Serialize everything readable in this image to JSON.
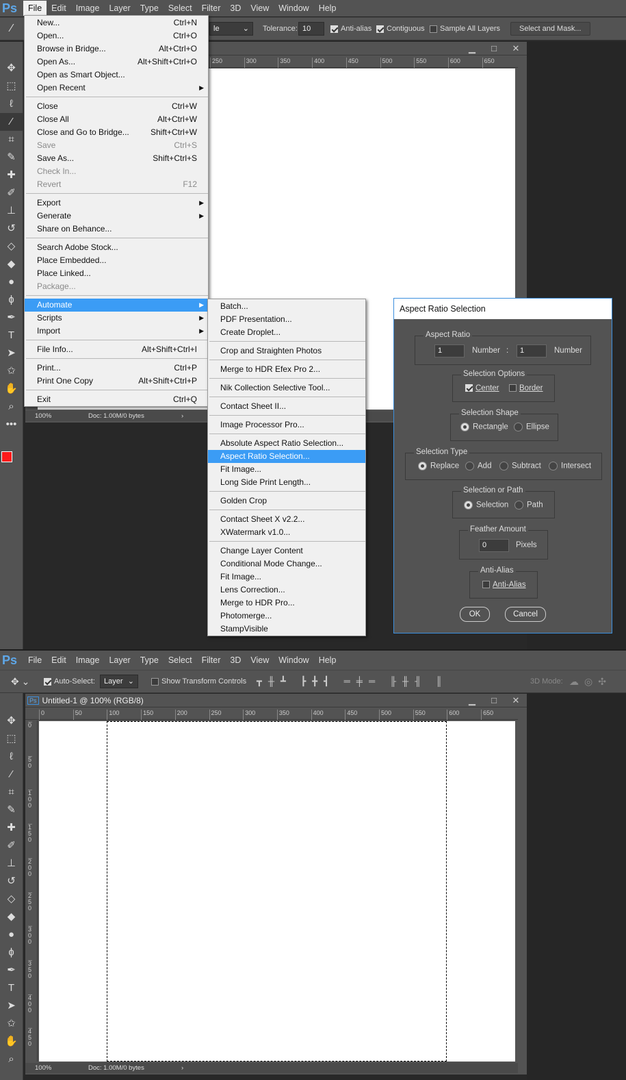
{
  "app_logo": "Ps",
  "menu": [
    "File",
    "Edit",
    "Image",
    "Layer",
    "Type",
    "Select",
    "Filter",
    "3D",
    "View",
    "Window",
    "Help"
  ],
  "top_options": {
    "style_value": "le",
    "tolerance_label": "Tolerance:",
    "tolerance_value": "10",
    "anti_alias": "Anti-alias",
    "anti_alias_checked": true,
    "contiguous": "Contiguous",
    "contiguous_checked": true,
    "sample_all": "Sample All Layers",
    "sample_all_checked": false,
    "select_mask": "Select and Mask..."
  },
  "bottom_options": {
    "auto_select": "Auto-Select:",
    "auto_select_checked": true,
    "layer_value": "Layer",
    "show_transform": "Show Transform Controls",
    "show_transform_checked": false,
    "mode_3d": "3D Mode:"
  },
  "document": {
    "title": "Untitled-1 @ 100% (RGB/8)",
    "zoom": "100%",
    "doc_info": "Doc: 1.00M/0 bytes",
    "hruler_top": [
      "250",
      "300",
      "350",
      "400",
      "450",
      "500",
      "550",
      "600",
      "650"
    ],
    "hruler": [
      "0",
      "50",
      "100",
      "150",
      "200",
      "250",
      "300",
      "350",
      "400",
      "450",
      "500",
      "550",
      "600",
      "650"
    ],
    "vruler": [
      "0",
      "50",
      "100",
      "150",
      "200",
      "250",
      "300",
      "350",
      "400",
      "450"
    ]
  },
  "colors": {
    "foreground": "#ff1a1a",
    "background": "#ffffff",
    "highlight": "#3b9cf5",
    "dialog_border": "#3c8fde"
  },
  "tools": [
    "move",
    "marquee",
    "lasso",
    "magic-wand",
    "crop",
    "eyedropper",
    "healing",
    "brush",
    "stamp",
    "history-brush",
    "eraser",
    "paint-bucket",
    "blur",
    "dodge",
    "pen",
    "type",
    "path-select",
    "shape",
    "hand",
    "zoom"
  ],
  "file_menu": [
    {
      "label": "New...",
      "sc": "Ctrl+N"
    },
    {
      "label": "Open...",
      "sc": "Ctrl+O"
    },
    {
      "label": "Browse in Bridge...",
      "sc": "Alt+Ctrl+O"
    },
    {
      "label": "Open As...",
      "sc": "Alt+Shift+Ctrl+O"
    },
    {
      "label": "Open as Smart Object..."
    },
    {
      "label": "Open Recent",
      "sub": true
    },
    {
      "sep": true
    },
    {
      "label": "Close",
      "sc": "Ctrl+W"
    },
    {
      "label": "Close All",
      "sc": "Alt+Ctrl+W"
    },
    {
      "label": "Close and Go to Bridge...",
      "sc": "Shift+Ctrl+W"
    },
    {
      "label": "Save",
      "sc": "Ctrl+S",
      "dis": true
    },
    {
      "label": "Save As...",
      "sc": "Shift+Ctrl+S"
    },
    {
      "label": "Check In...",
      "dis": true
    },
    {
      "label": "Revert",
      "sc": "F12",
      "dis": true
    },
    {
      "sep": true
    },
    {
      "label": "Export",
      "sub": true
    },
    {
      "label": "Generate",
      "sub": true
    },
    {
      "label": "Share on Behance..."
    },
    {
      "sep": true
    },
    {
      "label": "Search Adobe Stock..."
    },
    {
      "label": "Place Embedded..."
    },
    {
      "label": "Place Linked..."
    },
    {
      "label": "Package...",
      "dis": true
    },
    {
      "sep": true
    },
    {
      "label": "Automate",
      "sub": true,
      "hl": true
    },
    {
      "label": "Scripts",
      "sub": true
    },
    {
      "label": "Import",
      "sub": true
    },
    {
      "sep": true
    },
    {
      "label": "File Info...",
      "sc": "Alt+Shift+Ctrl+I"
    },
    {
      "sep": true
    },
    {
      "label": "Print...",
      "sc": "Ctrl+P"
    },
    {
      "label": "Print One Copy",
      "sc": "Alt+Shift+Ctrl+P"
    },
    {
      "sep": true
    },
    {
      "label": "Exit",
      "sc": "Ctrl+Q"
    }
  ],
  "automate_menu": [
    {
      "label": "Batch..."
    },
    {
      "label": "PDF Presentation..."
    },
    {
      "label": "Create Droplet..."
    },
    {
      "sep": true
    },
    {
      "label": "Crop and Straighten Photos"
    },
    {
      "sep": true
    },
    {
      "label": "Merge to HDR Efex Pro 2..."
    },
    {
      "sep": true
    },
    {
      "label": "Nik Collection Selective Tool..."
    },
    {
      "sep": true
    },
    {
      "label": "Contact Sheet II..."
    },
    {
      "sep": true
    },
    {
      "label": "Image Processor Pro..."
    },
    {
      "sep": true
    },
    {
      "label": "Absolute Aspect Ratio Selection..."
    },
    {
      "label": "Aspect Ratio Selection...",
      "hl": true
    },
    {
      "label": "Fit Image..."
    },
    {
      "label": "Long Side Print Length..."
    },
    {
      "sep": true
    },
    {
      "label": "Golden Crop"
    },
    {
      "sep": true
    },
    {
      "label": "Contact Sheet X v2.2..."
    },
    {
      "label": "XWatermark v1.0..."
    },
    {
      "sep": true
    },
    {
      "label": "Change Layer Content"
    },
    {
      "label": "Conditional Mode Change..."
    },
    {
      "label": "Fit Image..."
    },
    {
      "label": "Lens Correction..."
    },
    {
      "label": "Merge to HDR Pro..."
    },
    {
      "label": "Photomerge..."
    },
    {
      "label": "StampVisible"
    }
  ],
  "dialog": {
    "title": "Aspect Ratio Selection",
    "aspect_ratio": {
      "label": "Aspect Ratio",
      "a": "1",
      "b": "1",
      "unit": "Number",
      "colon": ":"
    },
    "options": {
      "label": "Selection Options",
      "center": "Center",
      "center_checked": true,
      "border": "Border",
      "border_checked": false
    },
    "shape": {
      "label": "Selection Shape",
      "rectangle": "Rectangle",
      "ellipse": "Ellipse",
      "selected": "Rectangle"
    },
    "type": {
      "label": "Selection Type",
      "replace": "Replace",
      "add": "Add",
      "subtract": "Subtract",
      "intersect": "Intersect",
      "selected": "Replace"
    },
    "sel_path": {
      "label": "Selection or Path",
      "selection": "Selection",
      "path": "Path",
      "selected": "Selection"
    },
    "feather": {
      "label": "Feather Amount",
      "value": "0",
      "unit": "Pixels"
    },
    "anti_alias": {
      "label": "Anti-Alias",
      "option": "Anti-Alias",
      "checked": false
    },
    "ok": "OK",
    "cancel": "Cancel"
  }
}
